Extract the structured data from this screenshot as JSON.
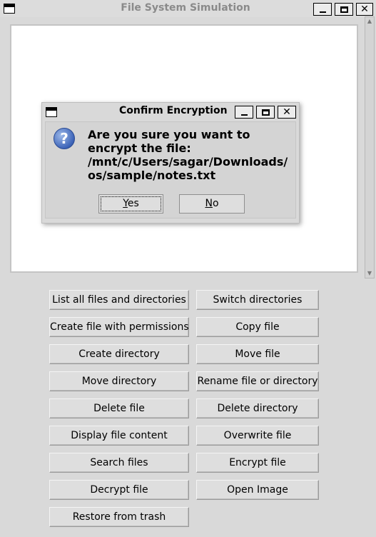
{
  "window": {
    "title": "File System Simulation",
    "minimize": "_",
    "maximize": "□",
    "close": "✕"
  },
  "buttons": {
    "left": [
      "List all files and directories",
      "Create file with permissions",
      "Create directory",
      "Move directory",
      "Delete file",
      "Display file content",
      "Search files",
      "Decrypt file",
      "Restore from trash"
    ],
    "right": [
      "Switch directories",
      "Copy file",
      "Move file",
      "Rename file or directory",
      "Delete directory",
      "Overwrite file",
      "Encrypt file",
      "Open Image"
    ]
  },
  "dialog": {
    "title": "Confirm Encryption",
    "icon": "question-icon",
    "message_lines": [
      "Are you sure you want to",
      "encrypt the file:",
      "/mnt/c/Users/sagar/Downloads/",
      "os/sample/notes.txt"
    ],
    "yes_label": {
      "mnemonic": "Y",
      "rest": "es"
    },
    "no_label": {
      "mnemonic": "N",
      "rest": "o"
    }
  }
}
